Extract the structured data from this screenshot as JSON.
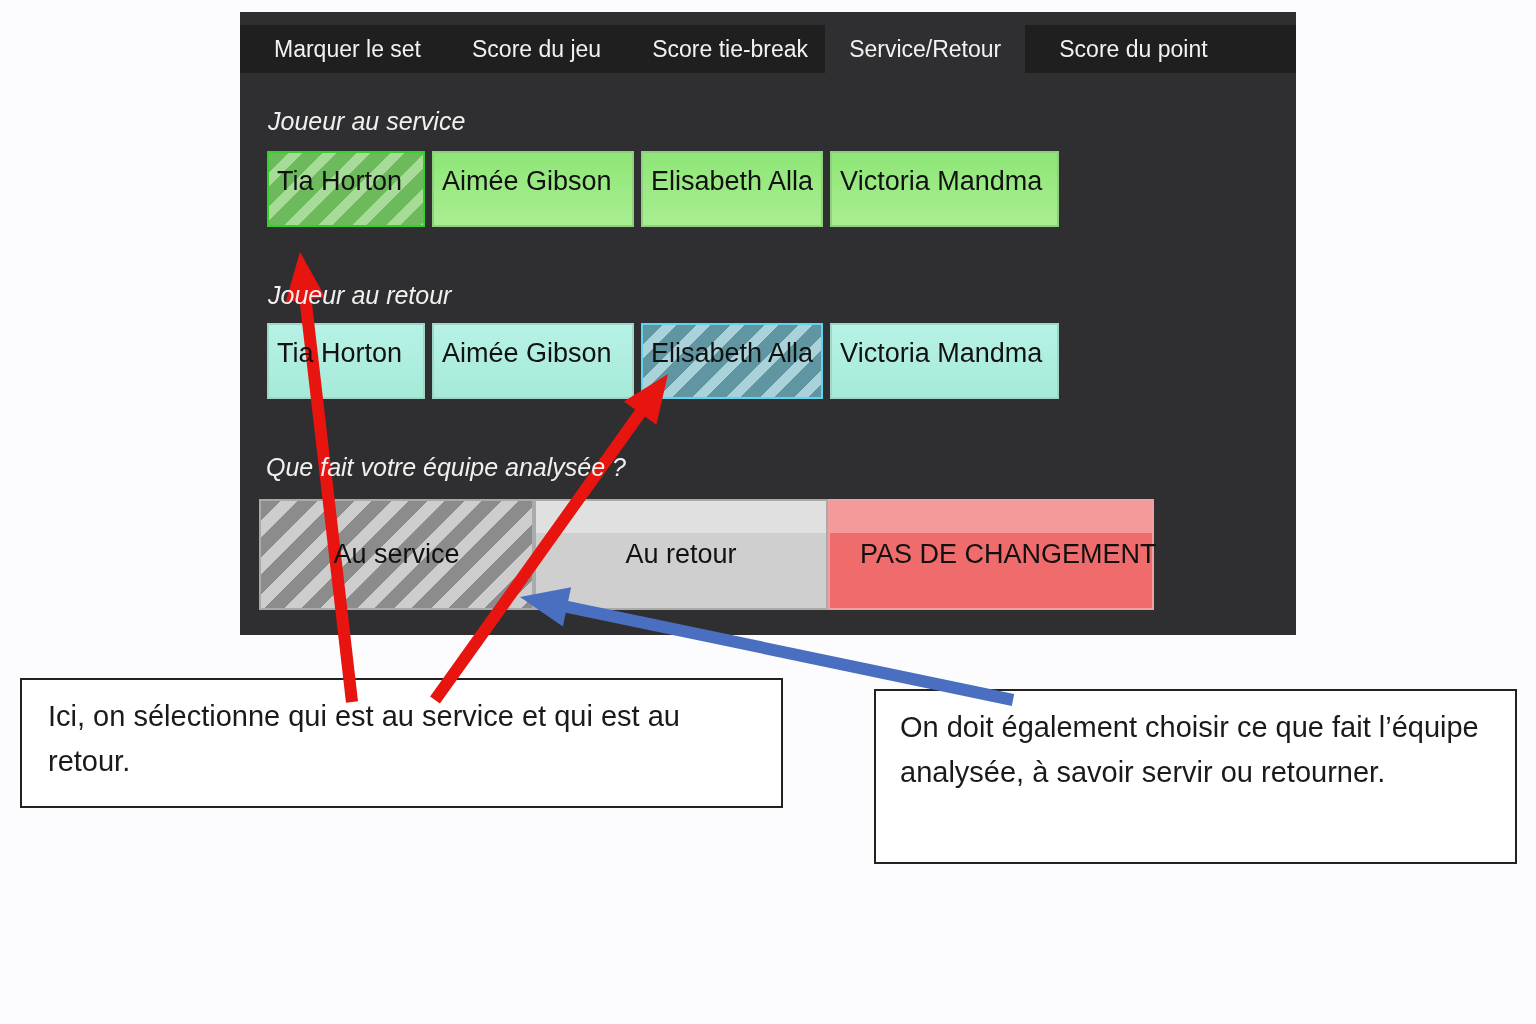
{
  "tabs": [
    {
      "label": "Marquer le set",
      "selected": false
    },
    {
      "label": "Score du jeu",
      "selected": false
    },
    {
      "label": "Score tie-break",
      "selected": false
    },
    {
      "label": "Service/Retour",
      "selected": true
    },
    {
      "label": "Score du point",
      "selected": false
    }
  ],
  "server": {
    "label": "Joueur au service",
    "players": [
      {
        "name": "Tia Horton",
        "selected": true
      },
      {
        "name": "Aimée Gibson",
        "selected": false
      },
      {
        "name": "Elisabeth Alla",
        "selected": false
      },
      {
        "name": "Victoria Mandma",
        "selected": false
      }
    ]
  },
  "returner": {
    "label": "Joueur au retour",
    "players": [
      {
        "name": "Tia Horton",
        "selected": false
      },
      {
        "name": "Aimée Gibson",
        "selected": false
      },
      {
        "name": "Elisabeth Alla",
        "selected": true
      },
      {
        "name": "Victoria Mandma",
        "selected": false
      }
    ]
  },
  "team": {
    "label": "Que fait votre équipe analysée ?",
    "options": [
      {
        "label": "Au service",
        "kind": "choice",
        "selected": true
      },
      {
        "label": "Au retour",
        "kind": "choice",
        "selected": false
      },
      {
        "label": "PAS DE CHANGEMENT",
        "kind": "reset",
        "selected": false
      }
    ]
  },
  "callouts": [
    "Ici, on sélectionne qui est au service et qui est au retour.",
    "On doit également choisir ce que fait l’équipe analysée, à savoir servir ou retourner."
  ],
  "arrows": [
    {
      "color": "#e8140f"
    },
    {
      "color": "#e8140f"
    },
    {
      "color": "#4a6fc0"
    }
  ]
}
